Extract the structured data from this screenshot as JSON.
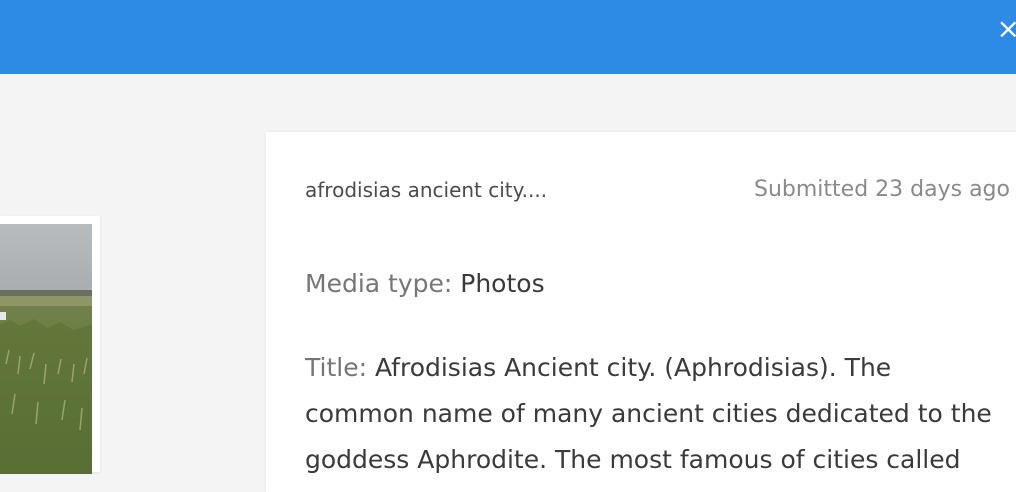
{
  "header": {
    "close_glyph": "×",
    "bar_color": "#2d8be6"
  },
  "thumbnail": {
    "description_icon": "landscape-photo"
  },
  "submission": {
    "name": "afrodisias ancient city....",
    "submitted": "Submitted 23 days ago",
    "media_type_label": "Media type:",
    "media_type_value": "Photos",
    "title_label": "Title:",
    "title_value": "Afrodisias Ancient city. (Aphrodisias). The common name of many ancient cities dedicated to the goddess Aphrodite. The most famous of cities called"
  }
}
